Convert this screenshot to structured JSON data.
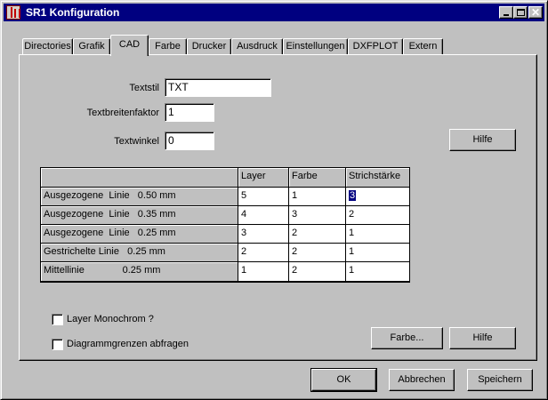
{
  "window": {
    "title": "SR1 Konfiguration"
  },
  "tabs": [
    {
      "label": "Directories",
      "active": false
    },
    {
      "label": "Grafik",
      "active": false
    },
    {
      "label": "CAD",
      "active": true
    },
    {
      "label": "Farbe",
      "active": false
    },
    {
      "label": "Drucker",
      "active": false
    },
    {
      "label": "Ausdruck",
      "active": false
    },
    {
      "label": "Einstellungen",
      "active": false
    },
    {
      "label": "DXFPLOT",
      "active": false
    },
    {
      "label": "Extern",
      "active": false
    }
  ],
  "form": {
    "textstil_label": "Textstil",
    "textstil_value": "TXT",
    "textbreite_label": "Textbreitenfaktor",
    "textbreite_value": "1",
    "textwinkel_label": "Textwinkel",
    "textwinkel_value": "0"
  },
  "grid": {
    "columns": [
      "",
      "Layer",
      "Farbe",
      "Strichstärke"
    ],
    "rows": [
      {
        "name": "Ausgezogene  Linie   0.50 mm",
        "layer": "5",
        "farbe": "1",
        "strich": "3"
      },
      {
        "name": "Ausgezogene  Linie   0.35 mm",
        "layer": "4",
        "farbe": "3",
        "strich": "2"
      },
      {
        "name": "Ausgezogene  Linie   0.25 mm",
        "layer": "3",
        "farbe": "2",
        "strich": "1"
      },
      {
        "name": "Gestrichelte Linie   0.25 mm",
        "layer": "2",
        "farbe": "2",
        "strich": "1"
      },
      {
        "name": "Mittellinie              0.25 mm",
        "layer": "1",
        "farbe": "2",
        "strich": "1"
      }
    ],
    "selected_cell": "Strichstärke row 1"
  },
  "checkboxes": {
    "layer_monochrom": {
      "label": "Layer Monochrom ?",
      "checked": false
    },
    "diagrammgrenzen": {
      "label": "Diagrammgrenzen abfragen",
      "checked": false
    }
  },
  "buttons": {
    "hilfe_top": "Hilfe",
    "farbe": "Farbe...",
    "hilfe_bottom": "Hilfe",
    "ok": "OK",
    "abbrechen": "Abbrechen",
    "speichern": "Speichern"
  }
}
